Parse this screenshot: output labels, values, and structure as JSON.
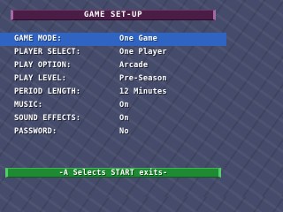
{
  "title": "GAME SET-UP",
  "menu": {
    "selected_index": 0,
    "items": [
      {
        "label": "GAME MODE:",
        "value": "One Game"
      },
      {
        "label": "PLAYER SELECT:",
        "value": "One Player"
      },
      {
        "label": "PLAY OPTION:",
        "value": "Arcade"
      },
      {
        "label": "PLAY LEVEL:",
        "value": "Pre-Season"
      },
      {
        "label": "PERIOD LENGTH:",
        "value": "12 Minutes"
      },
      {
        "label": "MUSIC:",
        "value": "On"
      },
      {
        "label": "SOUND EFFECTS:",
        "value": "On"
      },
      {
        "label": "PASSWORD:",
        "value": "No"
      }
    ]
  },
  "footer": {
    "hint": "-A Selects  START exits-"
  },
  "colors": {
    "background": "#454b6a",
    "title_bar": "#4a1c46",
    "selection": "#2f64c2",
    "footer_bar": "#1e8a32"
  }
}
